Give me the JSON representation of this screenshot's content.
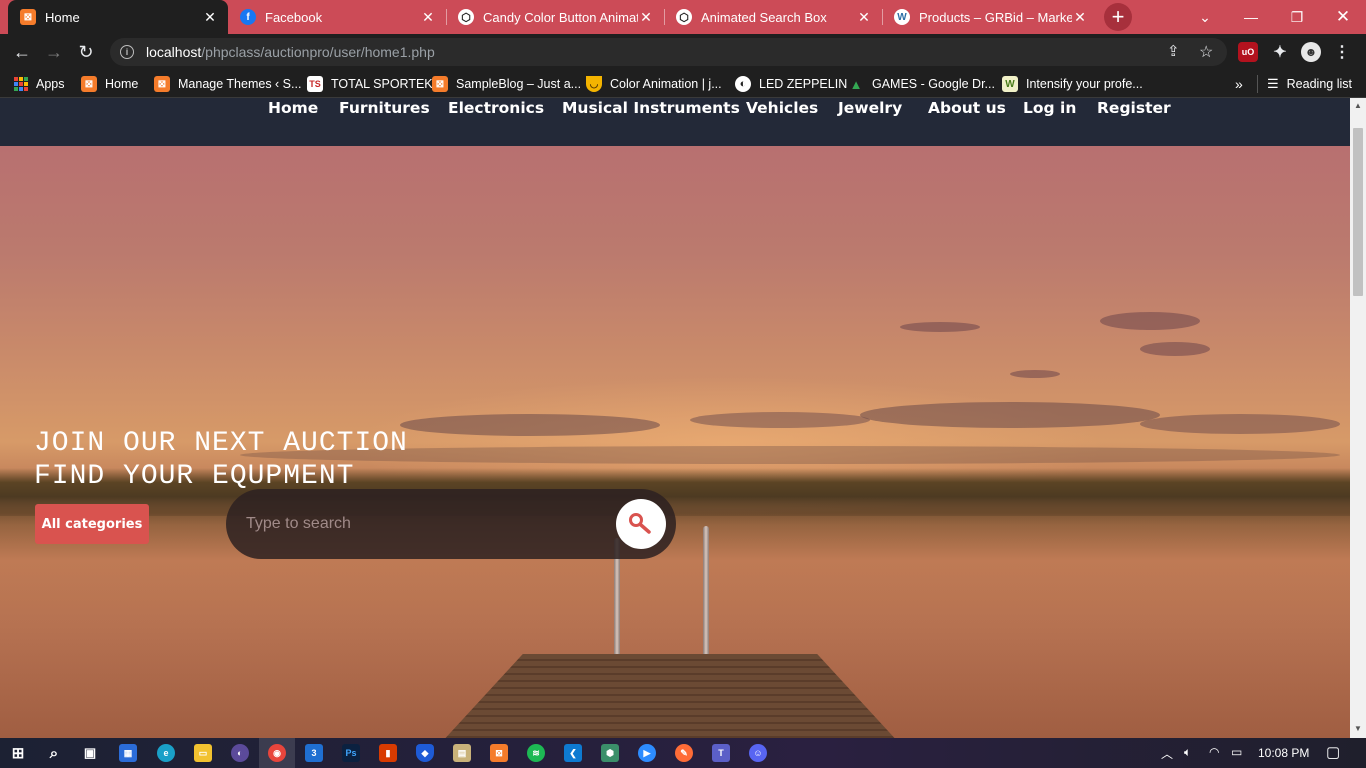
{
  "browser": {
    "tabs": [
      {
        "title": "Home",
        "favicon": "xampp-icon",
        "active": true
      },
      {
        "title": "Facebook",
        "favicon": "facebook-icon",
        "active": false
      },
      {
        "title": "Candy Color Button Animatic",
        "favicon": "codepen-icon",
        "active": false
      },
      {
        "title": "Animated Search Box",
        "favicon": "codepen-icon",
        "active": false
      },
      {
        "title": "Products – GRBid – Marketpl",
        "favicon": "wordpress-icon",
        "active": false
      }
    ],
    "address": {
      "host": "localhost",
      "path": "/phpclass/auctionpro/user/home1.php"
    },
    "bookmarks": [
      {
        "label": "Apps",
        "icon": "apps-grid-icon"
      },
      {
        "label": "Home",
        "icon": "xampp-icon"
      },
      {
        "label": "Manage Themes ‹ S...",
        "icon": "xampp-icon"
      },
      {
        "label": "TOTAL SPORTEK",
        "icon": "totalsportek-icon"
      },
      {
        "label": "SampleBlog – Just a...",
        "icon": "xampp-icon"
      },
      {
        "label": "Color Animation | j...",
        "icon": "shield-icon"
      },
      {
        "label": "LED ZEPPELIN",
        "icon": "globe-icon"
      },
      {
        "label": "GAMES - Google Dr...",
        "icon": "google-drive-icon"
      },
      {
        "label": "Intensify your profe...",
        "icon": "w-icon"
      }
    ],
    "more_bookmarks": "»",
    "reading_list": "Reading list",
    "tab_strip_color": "#cc4b57"
  },
  "site": {
    "nav": [
      "Home",
      "Furnitures",
      "Electronics",
      "Musical Instruments",
      "Vehicles",
      "Jewelry",
      "About us",
      "Log in",
      "Register"
    ],
    "hero": {
      "heading_line1": "JOIN OUR NEXT AUCTION",
      "heading_line2": "FIND YOUR EQUPMENT",
      "category_button": "All categories",
      "search_placeholder": "Type to search"
    },
    "accent": "#d9534f",
    "nav_bg": "#232938"
  },
  "taskbar": {
    "time": "10:08 PM",
    "apps": [
      "windows-start-icon",
      "search-icon",
      "task-view-icon",
      "store-icon",
      "edge-icon",
      "file-explorer-icon",
      "eclipse-icon",
      "chrome-icon",
      "css3-icon",
      "photoshop-icon",
      "office-icon",
      "brave-icon",
      "app-icon",
      "xampp-icon",
      "spotify-icon",
      "vscode-icon",
      "app-icon",
      "zoom-icon",
      "postman-icon",
      "teams-icon",
      "discord-icon"
    ]
  }
}
